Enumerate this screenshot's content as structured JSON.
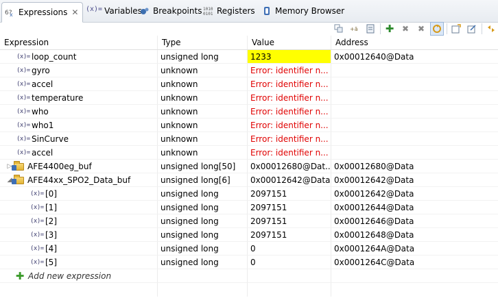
{
  "tabs": [
    {
      "icon": "expressions-icon",
      "label": "Expressions",
      "active": true
    },
    {
      "icon_text": "(x)=",
      "label": "Variables"
    },
    {
      "icon": "breakpoints-icon",
      "label": "Breakpoints"
    },
    {
      "icon": "registers-icon",
      "label": "Registers"
    },
    {
      "icon": "memory-icon",
      "label": "Memory Browser"
    }
  ],
  "columns": [
    "Expression",
    "Type",
    "Value",
    "Address"
  ],
  "rows": [
    {
      "name": "loop_count",
      "type": "unsigned long",
      "value": "1233",
      "address": "0x00012640@Data",
      "highlight": true
    },
    {
      "name": "gyro",
      "type": "unknown",
      "value": "Error: identifier n...",
      "address": "",
      "error": true
    },
    {
      "name": "accel",
      "type": "unknown",
      "value": "Error: identifier n...",
      "address": "",
      "error": true
    },
    {
      "name": "temperature",
      "type": "unknown",
      "value": "Error: identifier n...",
      "address": "",
      "error": true
    },
    {
      "name": "who",
      "type": "unknown",
      "value": "Error: identifier n...",
      "address": "",
      "error": true
    },
    {
      "name": "who1",
      "type": "unknown",
      "value": "Error: identifier n...",
      "address": "",
      "error": true
    },
    {
      "name": "SinCurve",
      "type": "unknown",
      "value": "Error: identifier n...",
      "address": "",
      "error": true
    },
    {
      "name": "accel",
      "type": "unknown",
      "value": "Error: identifier n...",
      "address": "",
      "error": true
    },
    {
      "name": "AFE4400eg_buf",
      "type": "unsigned long[50]",
      "value": "0x00012680@Dat...",
      "address": "0x00012680@Data",
      "kind": "array",
      "expanded": false
    },
    {
      "name": "AFE44xx_SPO2_Data_buf",
      "type": "unsigned long[6]",
      "value": "0x00012642@Data",
      "address": "0x00012642@Data",
      "kind": "array",
      "expanded": true
    },
    {
      "name": "[0]",
      "type": "unsigned long",
      "value": "2097151",
      "address": "0x00012642@Data",
      "child": true
    },
    {
      "name": "[1]",
      "type": "unsigned long",
      "value": "2097151",
      "address": "0x00012644@Data",
      "child": true
    },
    {
      "name": "[2]",
      "type": "unsigned long",
      "value": "2097151",
      "address": "0x00012646@Data",
      "child": true
    },
    {
      "name": "[3]",
      "type": "unsigned long",
      "value": "2097151",
      "address": "0x00012648@Data",
      "child": true
    },
    {
      "name": "[4]",
      "type": "unsigned long",
      "value": "0",
      "address": "0x0001264A@Data",
      "child": true
    },
    {
      "name": "[5]",
      "type": "unsigned long",
      "value": "0",
      "address": "0x0001264C@Data",
      "child": true
    }
  ],
  "add_expression_label": "Add new expression",
  "var_icon_text": "(x)=",
  "colors": {
    "highlight": "#ffff00",
    "error": "#e00000"
  }
}
